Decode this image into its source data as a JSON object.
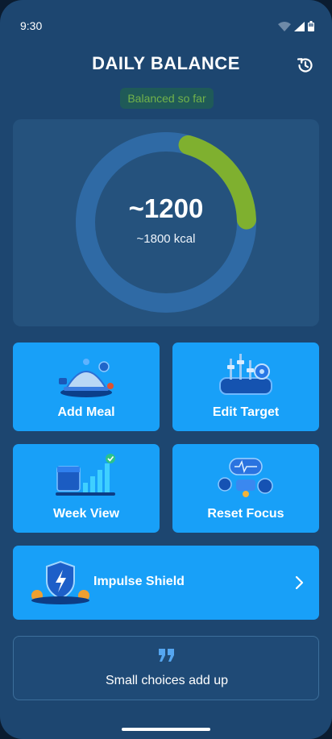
{
  "status_bar": {
    "time": "9:30",
    "icons": [
      "wifi-icon",
      "signal-icon",
      "battery-icon"
    ]
  },
  "header": {
    "title": "DAILY BALANCE",
    "history_icon": "history-icon"
  },
  "status_badge": {
    "text": "Balanced so far"
  },
  "summary": {
    "value": "~1200",
    "target": "~1800 kcal",
    "progress_fraction": 0.2
  },
  "actions": [
    {
      "label": "Add Meal",
      "icon": "serving-dome-icon"
    },
    {
      "label": "Edit Target",
      "icon": "target-sliders-icon"
    },
    {
      "label": "Week View",
      "icon": "weekly-chart-icon"
    },
    {
      "label": "Reset Focus",
      "icon": "wellness-items-icon"
    }
  ],
  "impulse": {
    "label": "Impulse Shield",
    "icon": "shield-icon",
    "chevron": "chevron-right-icon"
  },
  "quote": {
    "text": "Small choices add up",
    "icon": "quote-icon"
  },
  "colors": {
    "background": "#1d4670",
    "card": "#25527d",
    "tile": "#18a0f8",
    "ring_track": "#2f6aa5",
    "ring_progress": "#7fb02f",
    "badge_text": "#72b24a"
  }
}
